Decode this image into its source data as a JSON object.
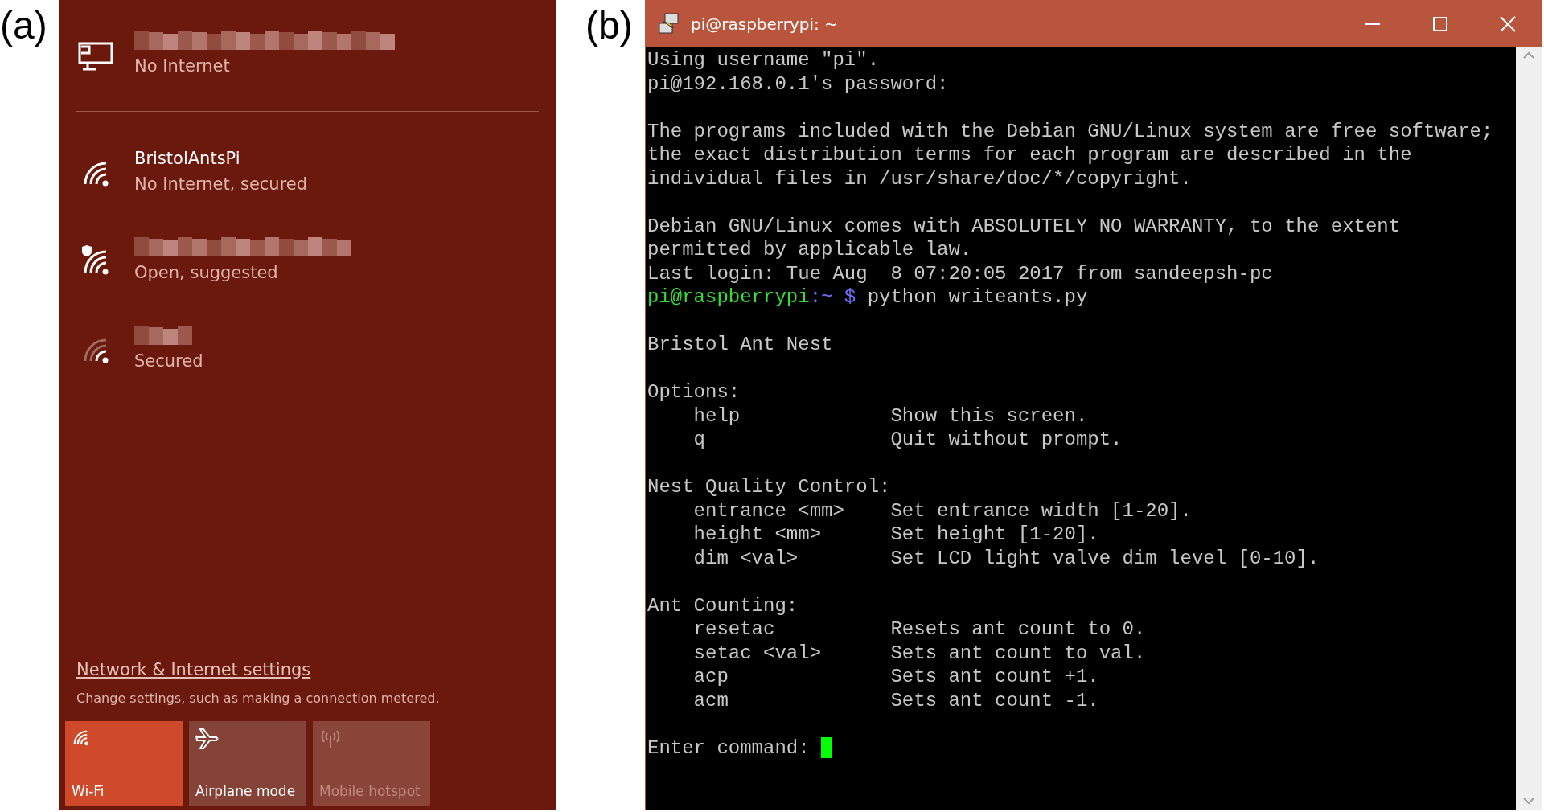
{
  "panel_a": {
    "label": "(a)",
    "networks": [
      {
        "kind": "wired",
        "status": "No Internet"
      },
      {
        "kind": "wifi",
        "name": "BristolAntsPi",
        "status": "No Internet, secured"
      },
      {
        "kind": "wifi_open",
        "status": "Open, suggested"
      },
      {
        "kind": "wifi_weak",
        "status": "Secured"
      }
    ],
    "settings_link": "Network & Internet settings",
    "settings_hint": "Change settings, such as making a connection metered.",
    "tiles": [
      {
        "kind": "wifi",
        "label": "Wi-Fi",
        "on": true,
        "disabled": false
      },
      {
        "kind": "airplane",
        "label": "Airplane mode",
        "on": false,
        "disabled": false
      },
      {
        "kind": "hotspot",
        "label": "Mobile hotspot",
        "on": false,
        "disabled": true
      }
    ]
  },
  "panel_b": {
    "label": "(b)",
    "window": {
      "title": "pi@raspberrypi: ~"
    },
    "lines": [
      {
        "kind": "text",
        "text": "Using username \"pi\"."
      },
      {
        "kind": "text",
        "text": "pi@192.168.0.1's password:"
      },
      {
        "kind": "blank"
      },
      {
        "kind": "text",
        "text": "The programs included with the Debian GNU/Linux system are free software;"
      },
      {
        "kind": "text",
        "text": "the exact distribution terms for each program are described in the"
      },
      {
        "kind": "text",
        "text": "individual files in /usr/share/doc/*/copyright."
      },
      {
        "kind": "blank"
      },
      {
        "kind": "text",
        "text": "Debian GNU/Linux comes with ABSOLUTELY NO WARRANTY, to the extent"
      },
      {
        "kind": "text",
        "text": "permitted by applicable law."
      },
      {
        "kind": "text",
        "text": "Last login: Tue Aug  8 07:20:05 2017 from sandeepsh-pc"
      },
      {
        "kind": "prompt",
        "user": "pi@raspberrypi",
        "path": ":~ $",
        "command": "python writeants.py"
      },
      {
        "kind": "blank"
      },
      {
        "kind": "text",
        "text": "Bristol Ant Nest"
      },
      {
        "kind": "blank"
      },
      {
        "kind": "text",
        "text": "Options:"
      },
      {
        "kind": "option",
        "command": "help",
        "description": "Show this screen."
      },
      {
        "kind": "option",
        "command": "q",
        "description": "Quit without prompt."
      },
      {
        "kind": "blank"
      },
      {
        "kind": "text",
        "text": "Nest Quality Control:"
      },
      {
        "kind": "option",
        "command": "entrance <mm>",
        "description": "Set entrance width [1-20]."
      },
      {
        "kind": "option",
        "command": "height <mm>",
        "description": "Set height [1-20]."
      },
      {
        "kind": "option",
        "command": "dim <val>",
        "description": "Set LCD light valve dim level [0-10]."
      },
      {
        "kind": "blank"
      },
      {
        "kind": "text",
        "text": "Ant Counting:"
      },
      {
        "kind": "option",
        "command": "resetac",
        "description": "Resets ant count to 0."
      },
      {
        "kind": "option",
        "command": "setac <val>",
        "description": "Sets ant count to val."
      },
      {
        "kind": "option",
        "command": "acp",
        "description": "Sets ant count +1."
      },
      {
        "kind": "option",
        "command": "acm",
        "description": "Sets ant count -1."
      },
      {
        "kind": "blank"
      },
      {
        "kind": "input",
        "text": "Enter command:"
      }
    ]
  }
}
